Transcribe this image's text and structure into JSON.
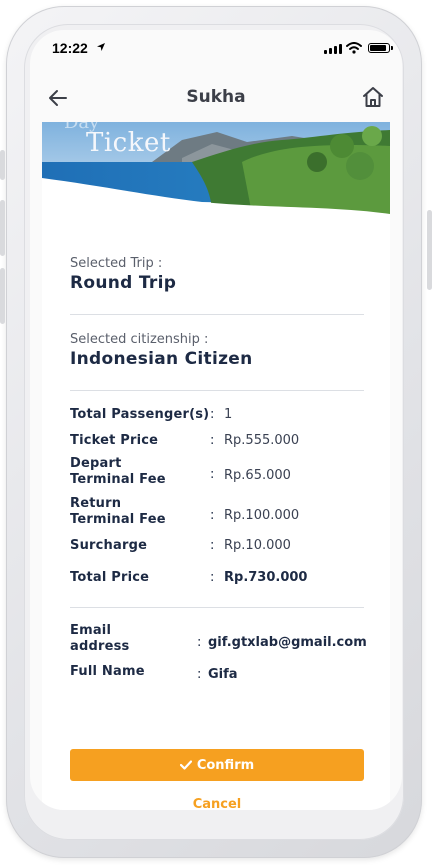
{
  "status_bar": {
    "time": "12:22"
  },
  "header": {
    "title": "Sukha"
  },
  "banner": {
    "ghost_text": "Day",
    "title": "Ticket"
  },
  "trip": {
    "label": "Selected Trip :",
    "value": "Round Trip"
  },
  "citizenship": {
    "label": "Selected citizenship :",
    "value": "Indonesian Citizen"
  },
  "summary": [
    {
      "key": "Total Passenger(s)",
      "colon": ":",
      "value": "1"
    },
    {
      "key": "Ticket Price",
      "colon": ":",
      "value": "Rp.555.000"
    },
    {
      "key": "Depart Terminal Fee",
      "colon": ":",
      "value": "Rp.65.000"
    },
    {
      "key": "Return Terminal Fee",
      "colon": ":",
      "value": "Rp.100.000"
    },
    {
      "key": "Surcharge",
      "colon": ":",
      "value": "Rp.10.000"
    },
    {
      "key": "Total Price",
      "colon": ":",
      "value": "Rp.730.000"
    }
  ],
  "contact": [
    {
      "key": "Email address",
      "colon": ":",
      "value": "gif.gtxlab@gmail.com"
    },
    {
      "key": "Full Name",
      "colon": ":",
      "value": "Gifa"
    }
  ],
  "actions": {
    "confirm_label": "Confirm",
    "cancel_label": "Cancel"
  },
  "colors": {
    "accent": "#f6a020",
    "text": "#1d2a44"
  },
  "icons": {
    "back": "arrow-left-icon",
    "home": "home-icon",
    "confirm": "check-icon",
    "location": "location-arrow-icon"
  }
}
